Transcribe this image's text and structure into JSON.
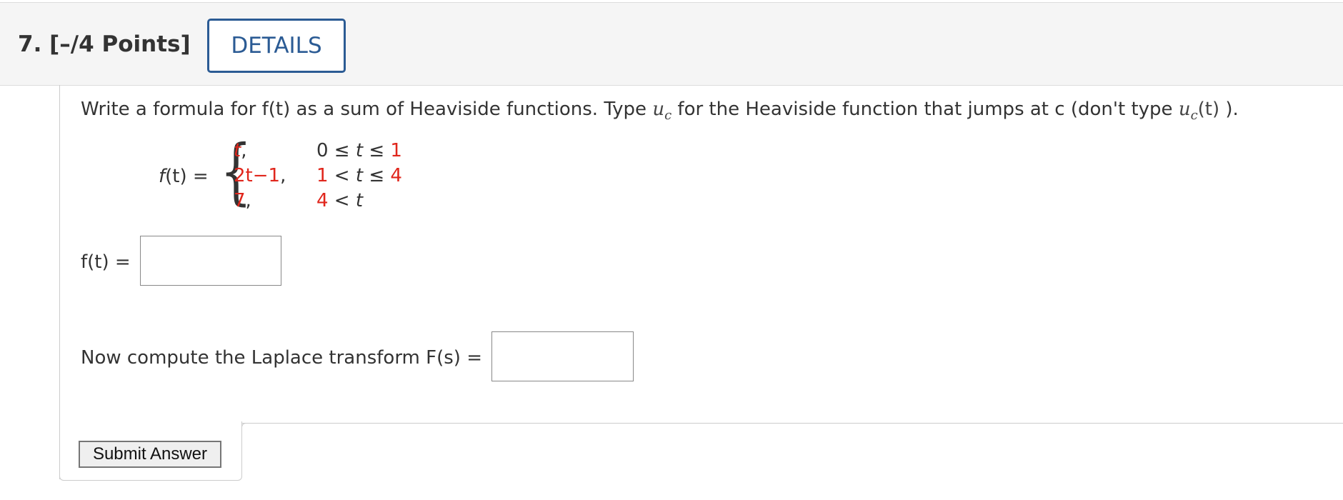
{
  "header": {
    "question_label": "7.  [–/4 Points]",
    "details_label": "DETAILS"
  },
  "question": {
    "instruction_before": "Write a formula for f(t) as a sum of Heaviside functions. Type ",
    "u_var": "u",
    "u_sub": "c",
    "instruction_middle": " for the Heaviside function that jumps at c (don't type ",
    "u2_var": "u",
    "u2_sub": "c",
    "u2_args": "(t)",
    "instruction_after": " )."
  },
  "piecewise": {
    "lhs_fn": "f",
    "lhs_args": "(t) =",
    "rows": [
      {
        "expr": "t",
        "expr_suffix": ",",
        "cond_left": "0",
        "cond_op1": " ≤ ",
        "cond_var": "t",
        "cond_op2": " ≤ ",
        "cond_right": "1"
      },
      {
        "expr": "2t−1",
        "expr_suffix": ",",
        "cond_left": "1",
        "cond_op1": " < ",
        "cond_var": "t",
        "cond_op2": " ≤ ",
        "cond_right": "4"
      },
      {
        "expr": "7",
        "expr_suffix": ",",
        "cond_left": "4",
        "cond_op1": " < ",
        "cond_var": "t",
        "cond_op2": "",
        "cond_right": ""
      }
    ]
  },
  "answers": {
    "ft_label": "f(t)  =",
    "ft_value": "",
    "laplace_label": "Now compute the Laplace transform F(s)  =",
    "laplace_value": ""
  },
  "submit_label": "Submit Answer",
  "colors": {
    "accent": "#2b5b94",
    "red_math": "#e0261c",
    "header_bg": "#f5f5f5"
  }
}
